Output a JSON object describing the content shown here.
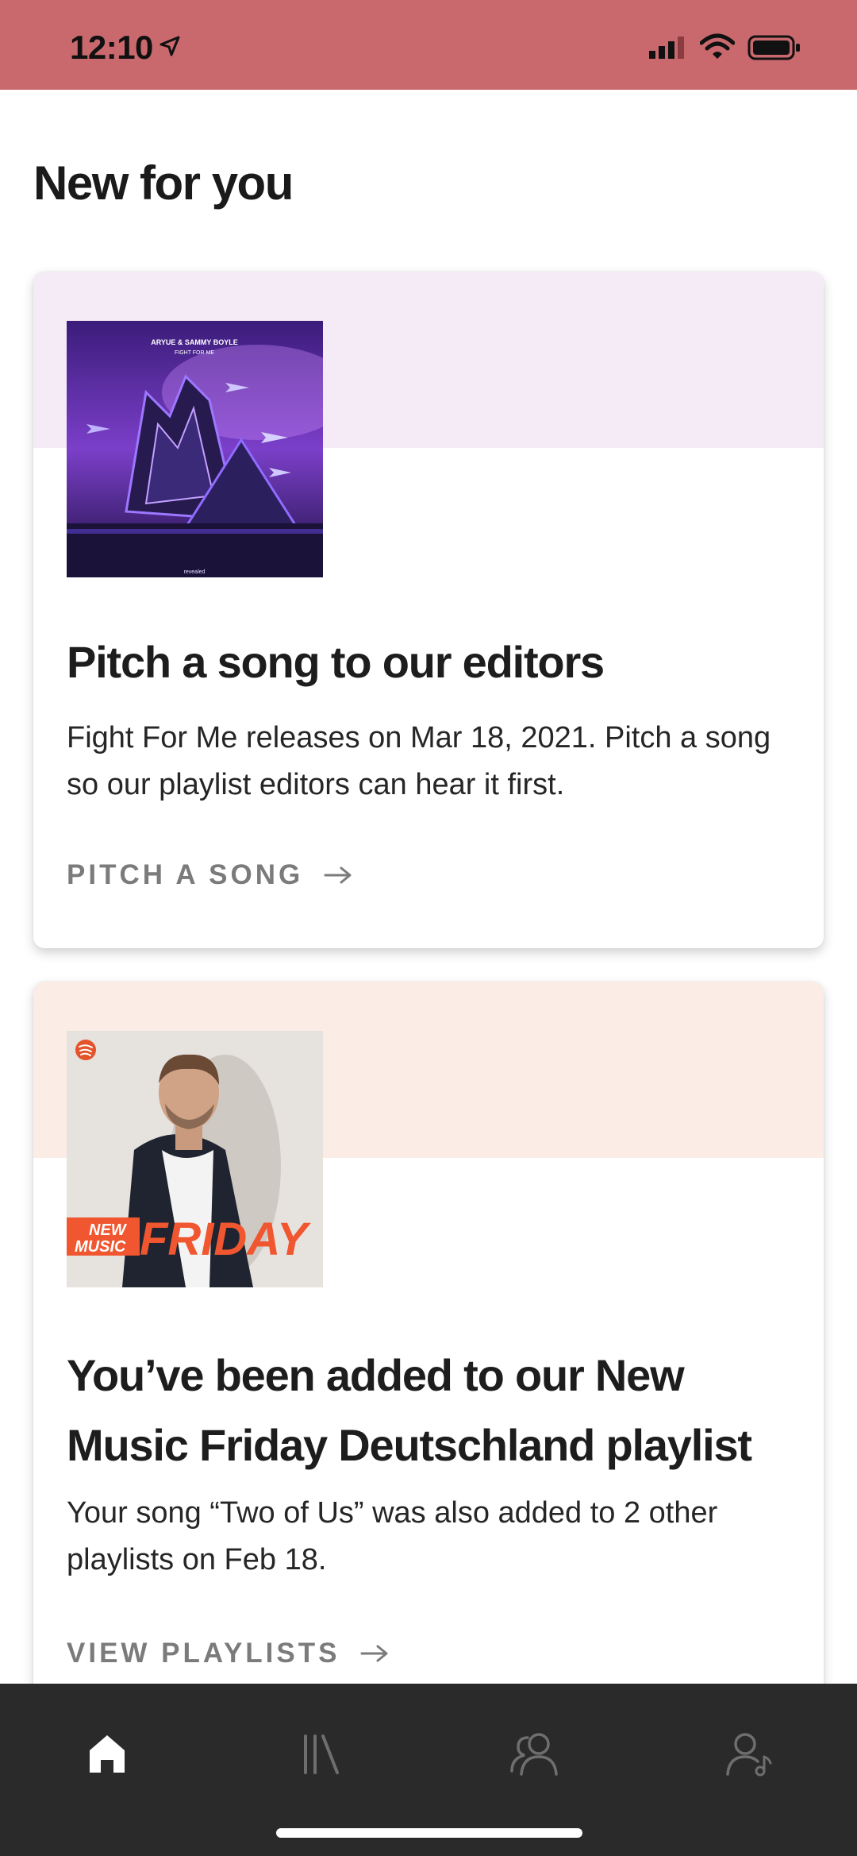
{
  "status_bar": {
    "time": "12:10",
    "icons": [
      "location-arrow-icon",
      "signal-icon",
      "wifi-icon",
      "battery-icon"
    ],
    "background": "#c9696d"
  },
  "page": {
    "title": "New for you"
  },
  "cards": [
    {
      "band_color": "#f5ebf6",
      "art": {
        "artist_line": "ARYUE & SAMMY BOYLE",
        "song_line": "FIGHT FOR ME",
        "label_line": "revealed"
      },
      "title": "Pitch a song to our editors",
      "body": "Fight For Me releases on Mar 18, 2021. Pitch a song so our playlist editors can hear it first.",
      "cta": "PITCH A SONG",
      "cta_icon": "arrow-right-icon"
    },
    {
      "band_color": "#fbece6",
      "art": {
        "badge_top": "NEW",
        "badge_bottom": "MUSIC",
        "word": "FRIDAY"
      },
      "title": "You’ve been added to our New Music Friday Deutschland playlist",
      "body": "Your song “Two of Us” was also added to 2 other playlists on Feb 18.",
      "cta": "VIEW PLAYLISTS",
      "cta_icon": "arrow-right-icon"
    }
  ],
  "tab_bar": {
    "tabs": [
      {
        "icon": "home-icon",
        "active": true
      },
      {
        "icon": "library-icon",
        "active": false
      },
      {
        "icon": "audience-icon",
        "active": false
      },
      {
        "icon": "profile-music-icon",
        "active": false
      }
    ],
    "background": "#2a2a2a"
  }
}
